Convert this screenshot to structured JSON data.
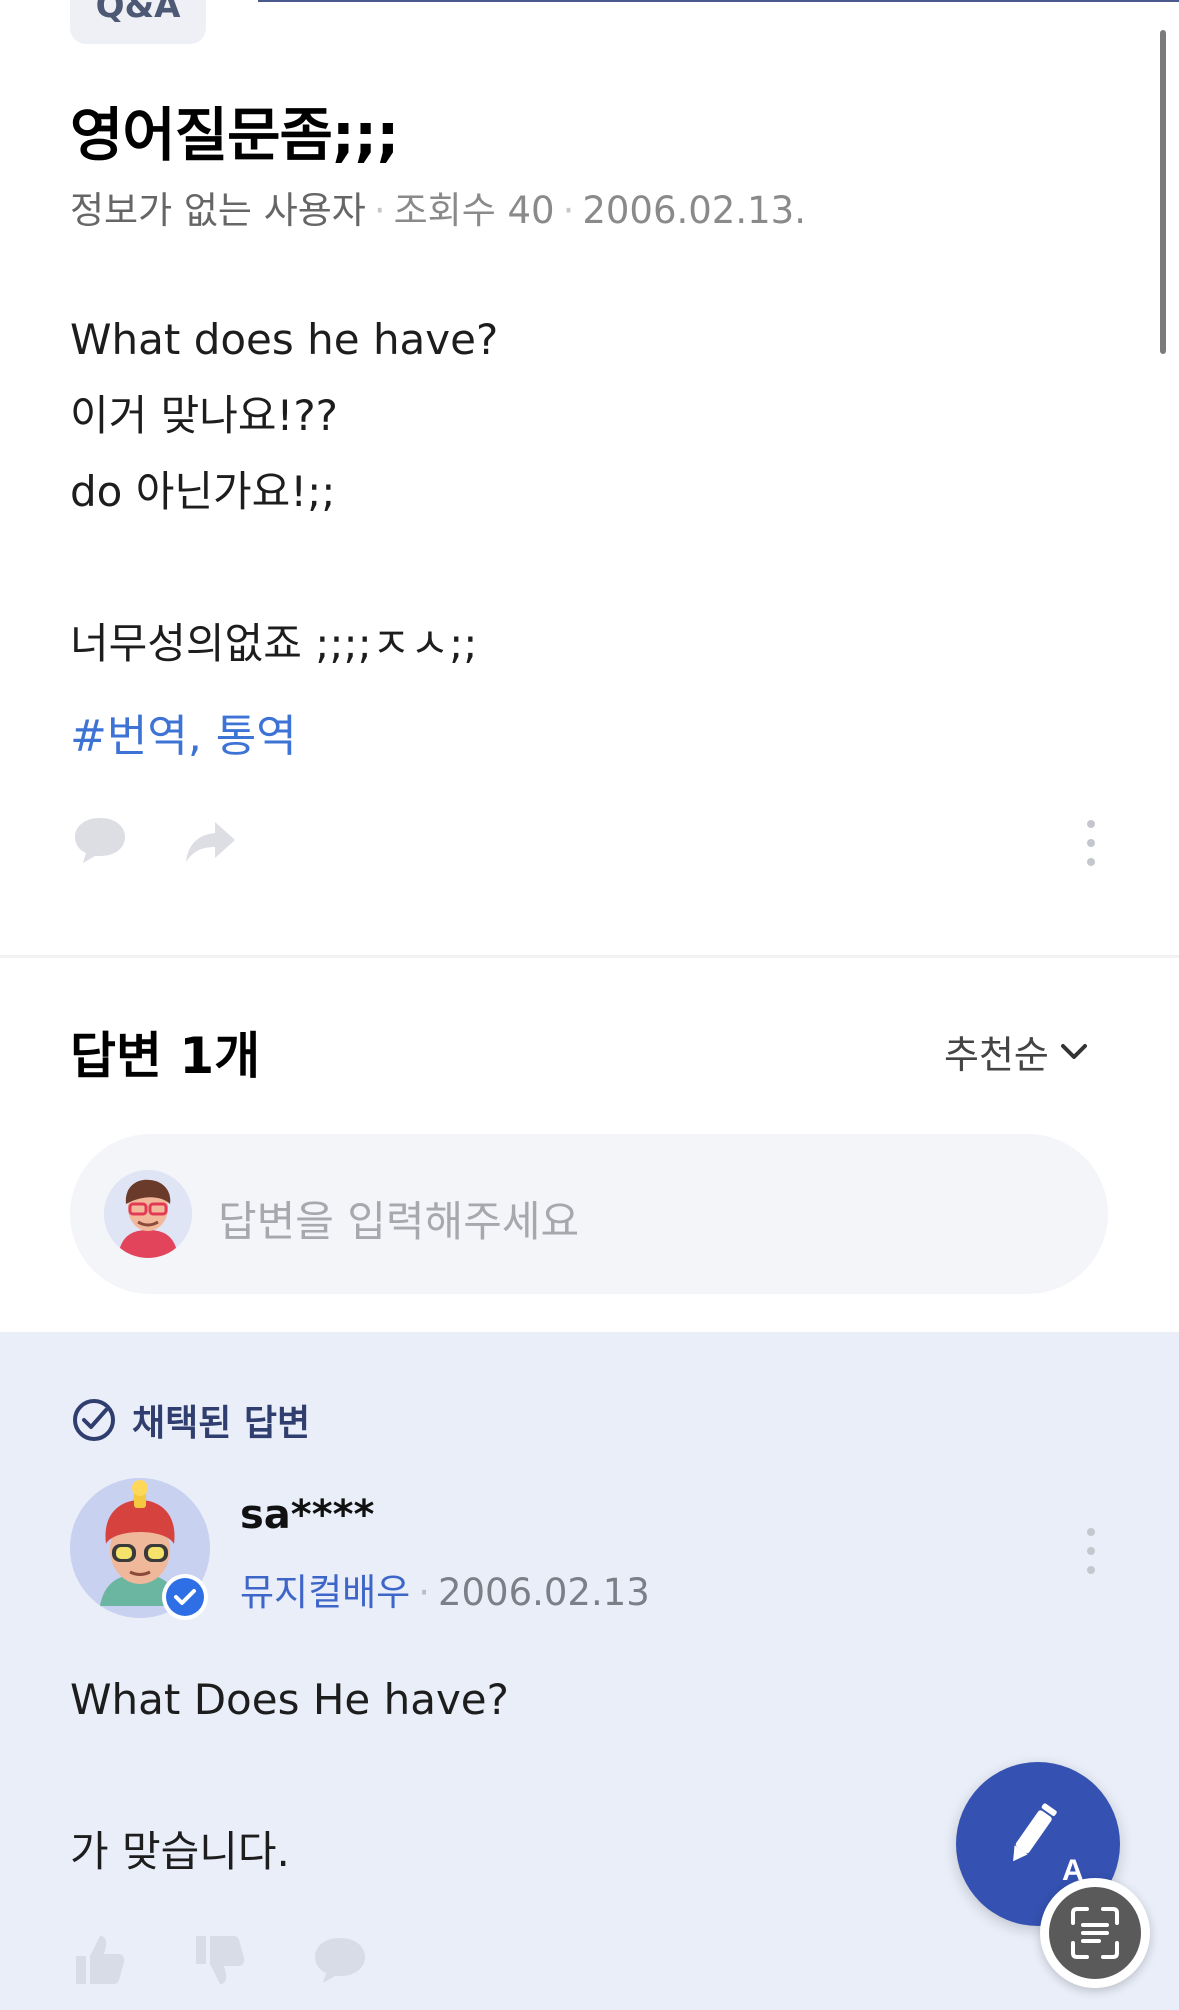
{
  "post": {
    "category_tag": "Q&A",
    "title": "영어질문좀;;;",
    "author": "정보가 없는 사용자",
    "views": "조회수 40",
    "date": "2006.02.13.",
    "lines": [
      "What does he have?",
      "이거 맞나요!??",
      "do 아닌가요!;;",
      "",
      "너무성의없죠 ;;;;ㅈㅅ;;"
    ],
    "hashtag": "#번역, 통역",
    "icons": [
      "comment-icon",
      "share-icon",
      "more-vertical-icon"
    ]
  },
  "answers": {
    "title": "답변 1개",
    "sort_label": "추천순",
    "input_placeholder": "답변을 입력해주세요"
  },
  "accepted_answer": {
    "badge_label": "채택된 답변",
    "user_name": "sa****",
    "user_job": "뮤지컬배우",
    "date": "2006.02.13",
    "lines": [
      "What Does He have?",
      "",
      "가 맞습니다."
    ],
    "icons": [
      "thumbs-up-icon",
      "thumbs-down-icon",
      "comment-icon"
    ]
  },
  "fab": {
    "icon": "write-answer-icon"
  },
  "colors": {
    "accent": "#3551b1",
    "hashtag": "#3e73d6",
    "answer_bg": "#e9eef9",
    "job": "#3e66c9"
  }
}
